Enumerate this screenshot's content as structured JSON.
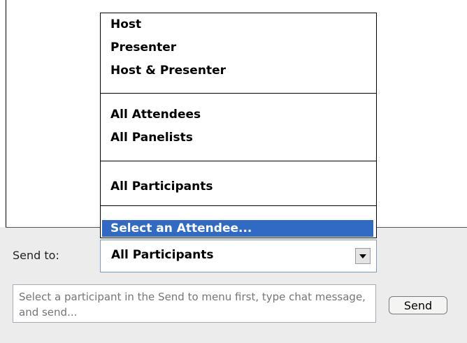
{
  "dropdown": {
    "items_group1": [
      "Host",
      "Presenter",
      "Host & Presenter"
    ],
    "items_group2": [
      "All Attendees",
      "All Panelists"
    ],
    "items_group3": [
      "All Participants"
    ],
    "selected_item": "Select an Attendee..."
  },
  "send_to": {
    "label": "Send to:",
    "value": "All Participants"
  },
  "message": {
    "placeholder": "Select a participant in the Send to menu first, type chat message, and send..."
  },
  "send_button": {
    "label": "Send"
  },
  "colors": {
    "selection": "#316ac5",
    "panel": "#ececec"
  },
  "icons": {
    "combo_arrow": "chevron-down-icon"
  }
}
